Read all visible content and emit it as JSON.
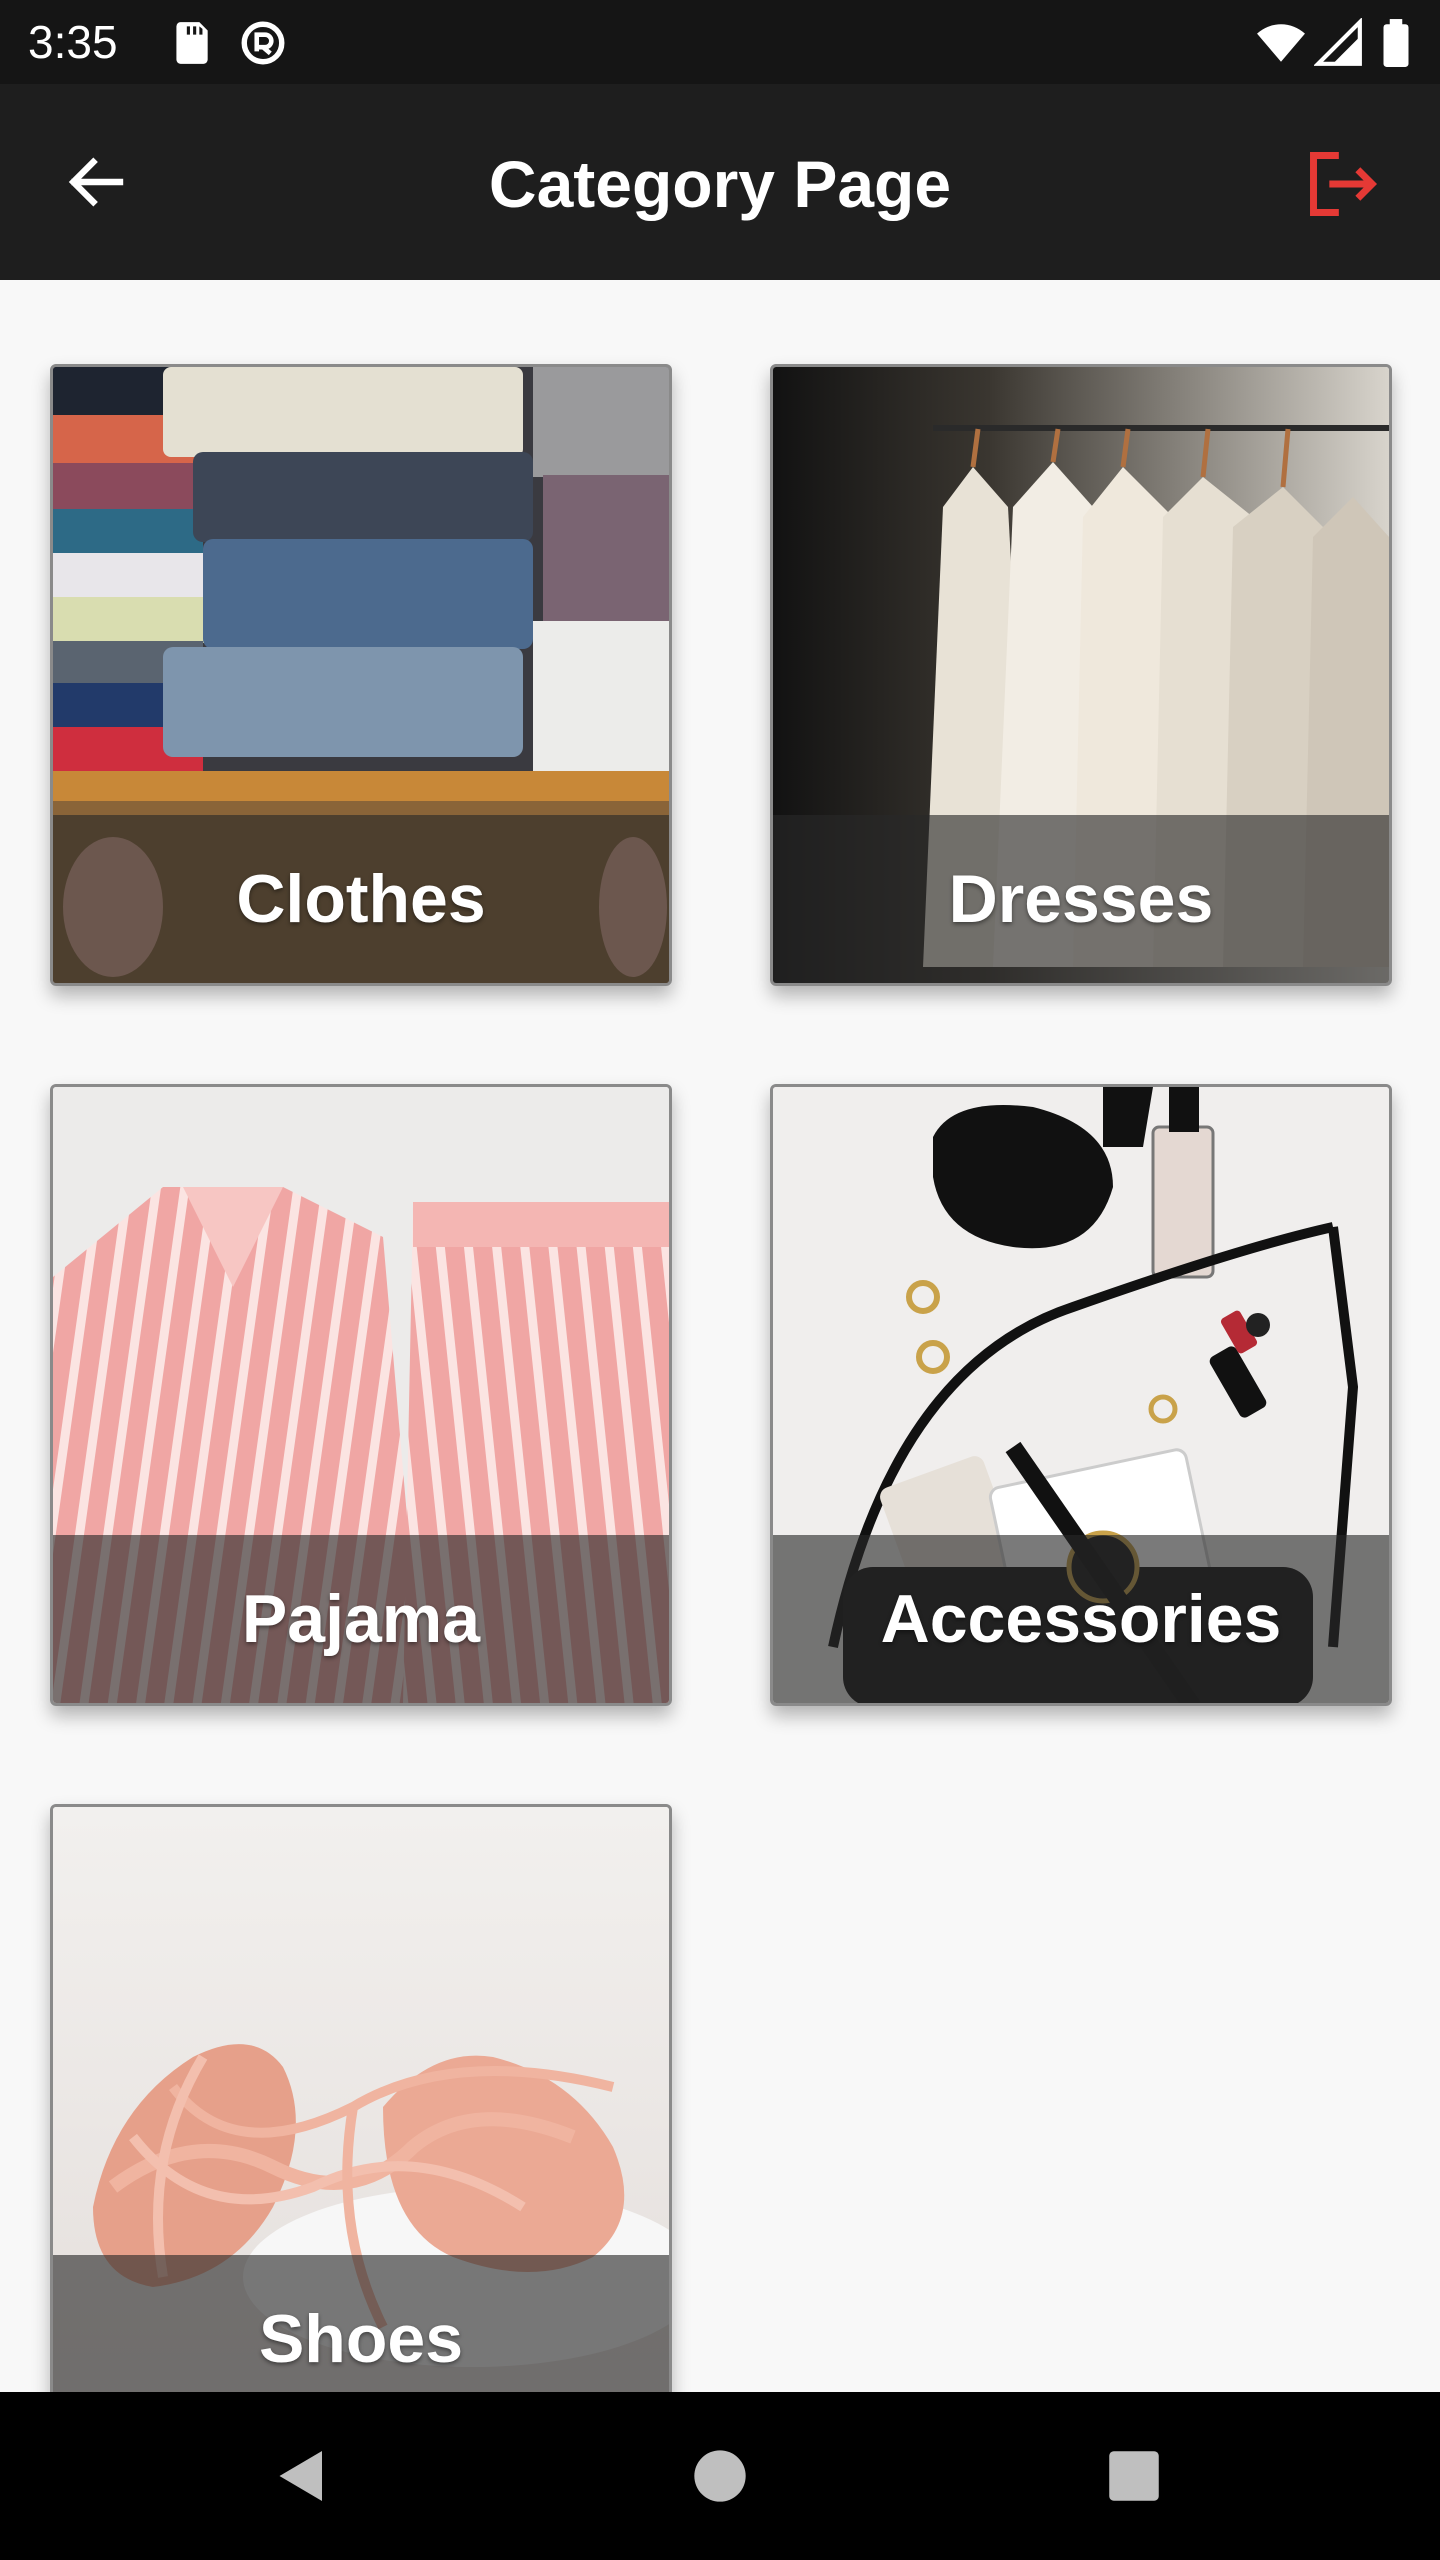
{
  "status_bar": {
    "time": "3:35",
    "icons": [
      "sd-card-icon",
      "vpn-icon",
      "wifi-icon",
      "signal-icon",
      "battery-icon"
    ]
  },
  "app_bar": {
    "title": "Category Page",
    "back_icon": "arrow-back-icon",
    "logout_icon": "logout-icon",
    "logout_color": "#e53935"
  },
  "categories": [
    {
      "label": "Clothes",
      "image": "folded-clothes-drawer"
    },
    {
      "label": "Dresses",
      "image": "white-dresses-on-rack"
    },
    {
      "label": "Pajama",
      "image": "pink-striped-pajamas"
    },
    {
      "label": "Accessories",
      "image": "sunglasses-bag-watch-flatlay"
    },
    {
      "label": "Shoes",
      "image": "pink-ballet-shoes"
    }
  ],
  "nav_bar": {
    "back_icon": "nav-back-icon",
    "home_icon": "nav-home-icon",
    "recents_icon": "nav-recents-icon"
  }
}
